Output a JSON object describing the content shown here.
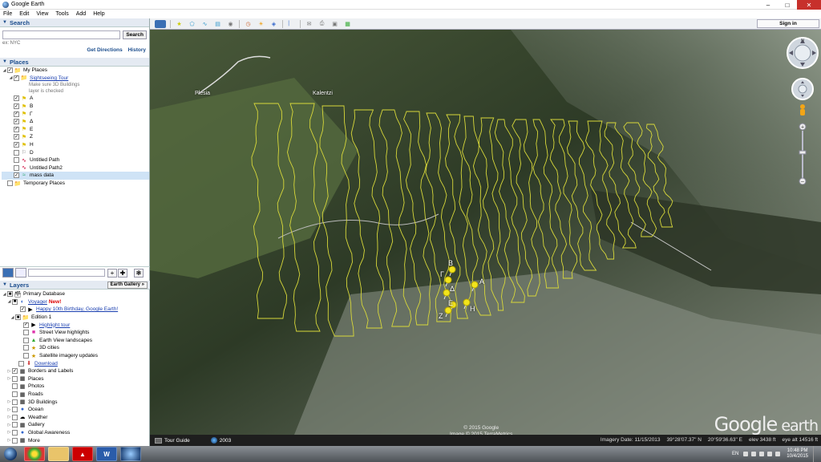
{
  "window": {
    "title": "Google Earth"
  },
  "menu": [
    "File",
    "Edit",
    "View",
    "Tools",
    "Add",
    "Help"
  ],
  "search": {
    "header": "Search",
    "placeholder": "",
    "button": "Search",
    "hint": "ex: NYC",
    "get_directions": "Get Directions",
    "history": "History"
  },
  "places": {
    "header": "Places",
    "items": [
      {
        "label": "My Places",
        "type": "folder",
        "checked": true
      },
      {
        "label": "Sightseeing Tour",
        "type": "tour",
        "checked": true,
        "link": true
      },
      {
        "label": "A",
        "type": "pin",
        "checked": true
      },
      {
        "label": "B",
        "type": "pin",
        "checked": true
      },
      {
        "label": "Γ",
        "type": "pin",
        "checked": true
      },
      {
        "label": "Δ",
        "type": "pin",
        "checked": true
      },
      {
        "label": "E",
        "type": "pin",
        "checked": true
      },
      {
        "label": "Z",
        "type": "pin",
        "checked": true
      },
      {
        "label": "H",
        "type": "pin",
        "checked": true
      },
      {
        "label": "D",
        "type": "pin-empty",
        "checked": false
      },
      {
        "label": "Untitled Path",
        "type": "path",
        "checked": false
      },
      {
        "label": "Untitled Path2",
        "type": "path",
        "checked": false
      },
      {
        "label": "mass data",
        "type": "data",
        "checked": true
      },
      {
        "label": "Temporary Places",
        "type": "folder",
        "checked": false
      }
    ],
    "tour_note_1": "Make sure 3D Buildings",
    "tour_note_2": "layer is checked"
  },
  "layers": {
    "header": "Layers",
    "gallery_button": "Earth Gallery »",
    "items": [
      {
        "label": "Primary Database",
        "type": "db",
        "checked": true
      },
      {
        "label": "Voyager",
        "new": "New!",
        "link": true,
        "checked": true
      },
      {
        "label": "Happy 10th Birthday, Google Earth!",
        "link": true,
        "checked": true
      },
      {
        "label": "Edition 1",
        "checked": true
      },
      {
        "label": "Highlight tour",
        "link": true,
        "checked": true
      },
      {
        "label": "Street View highlights",
        "checked": false
      },
      {
        "label": "Earth View landscapes",
        "checked": false
      },
      {
        "label": "3D cities",
        "checked": false
      },
      {
        "label": "Satellite imagery updates",
        "checked": false
      },
      {
        "label": "Download",
        "link": true,
        "checked": false
      },
      {
        "label": "Borders and Labels",
        "checked": true
      },
      {
        "label": "Places",
        "checked": false
      },
      {
        "label": "Photos",
        "checked": false
      },
      {
        "label": "Roads",
        "checked": false
      },
      {
        "label": "3D Buildings",
        "checked": false
      },
      {
        "label": "Ocean",
        "checked": false
      },
      {
        "label": "Weather",
        "checked": false
      },
      {
        "label": "Gallery",
        "checked": false
      },
      {
        "label": "Global Awareness",
        "checked": false
      },
      {
        "label": "More",
        "checked": false
      }
    ]
  },
  "toolbar": {
    "sign_in": "Sign in"
  },
  "map": {
    "places": {
      "plesia": "Plesia",
      "kalentzi": "Kalentzi"
    },
    "markers": {
      "b": "B",
      "g": "Γ",
      "a": "A",
      "d": "Δ",
      "e": "E",
      "h": "H",
      "z": "Z"
    },
    "copyright_1": "© 2015 Google",
    "copyright_2": "Image © 2015 TerraMetrics",
    "logo_google": "Google",
    "logo_earth": " earth",
    "nav_north": "N"
  },
  "status": {
    "tour_guide": "Tour Guide",
    "year": "2003",
    "imagery_date": "Imagery Date: 11/15/2013",
    "lat": "39°28'07.37\" N",
    "lon": "20°59'36.63\" E",
    "elev": "elev  3438 ft",
    "eye_alt": "eye alt  14516 ft"
  },
  "taskbar": {
    "lang": "EN",
    "time": "10:48 PM",
    "date": "10/4/2015"
  },
  "colors": {
    "path": "#d8d83a",
    "pin": "#f2e41c",
    "accent": "#1a4c8c"
  }
}
